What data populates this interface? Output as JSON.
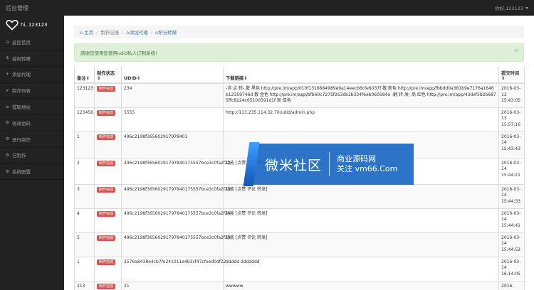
{
  "topbar": {
    "brand": "后台管理",
    "user": "你好,123123"
  },
  "sidebar": {
    "greeting": "hi, 123123",
    "items": [
      {
        "icon": "home-icon",
        "glyph": "⌂",
        "label": "返回首页"
      },
      {
        "icon": "money-icon",
        "glyph": "$",
        "label": "授权转赠"
      },
      {
        "icon": "plus-icon",
        "glyph": "+",
        "label": "添加代理"
      },
      {
        "icon": "check-icon",
        "glyph": "✔",
        "label": "制作列表"
      },
      {
        "icon": "list-icon",
        "glyph": "≡",
        "label": "提取地址"
      },
      {
        "icon": "gear-icon",
        "glyph": "⚙",
        "label": "修改密码"
      },
      {
        "icon": "gear-icon",
        "glyph": "⚙",
        "label": "进行制作"
      },
      {
        "icon": "gear-icon",
        "glyph": "⚙",
        "label": "已制作"
      },
      {
        "icon": "gear-icon",
        "glyph": "⚙",
        "label": "系统配置"
      }
    ]
  },
  "breadcrumb": [
    {
      "label": "⌂ 主页",
      "active": false
    },
    {
      "label": "制作记录",
      "active": true
    },
    {
      "label": "⌂添加代理",
      "active": false
    },
    {
      "label": "⌂积分转赠",
      "active": false
    }
  ],
  "alert": {
    "text": "感谢您使用您使用udid私人订制系统!",
    "close": "×"
  },
  "table": {
    "headers": [
      "备注⇕",
      "制作状态 ⇕",
      "UDID⇕",
      "下载链接⇕",
      "提交时间⇕"
    ],
    "rows": [
      {
        "note": "123123",
        "status": "制作完成",
        "udid": "234",
        "link": "-详 点 转- 散 黑色 http://pre.im/app/010f1316684989e9a14eecb6cfe6037f 散 粉色 http://pre.im/app/fbbdd0a381b9e7176a1646b12359746d 散 金色 http://pre.im/app/bfb60c7275f263db2b334f6eb060584a -翻 转 发- 商 红色 http://pre.im/app/43def5b2b6875ffc8224c65100591d1f 商 厚色",
        "time": "2016-03-13 15:43:05"
      },
      {
        "note": "123456",
        "status": "制作完成",
        "udid": "5555",
        "link": "http://113.235.114.32:70/udid/admin.php",
        "time": "2016-03-13 15:57:16"
      },
      {
        "note": "1",
        "status": "制作完成",
        "udid": "496c2198f365602917978401",
        "link": "",
        "time": "2016-03-14 15:43:43"
      },
      {
        "note": "2",
        "status": "制作完成",
        "udid": "496c2198f36560291797840175557bce3c0fa2f22",
        "link": "功能 [点赞 评论 转发]",
        "time": "2016-03-14 15:44:21"
      },
      {
        "note": "3",
        "status": "制作完成",
        "udid": "496c2198f36560291797840175557bce3c0fa2f23",
        "link": "功能 [点赞 评论 转发]",
        "time": "2016-03-14 15:44:33"
      },
      {
        "note": "4",
        "status": "制作完成",
        "udid": "496c2198f36560291797840175557bce3c0fa2f24",
        "link": "功能 [点赞 评论 转发]",
        "time": "2016-03-14 15:44:41"
      },
      {
        "note": "5",
        "status": "制作完成",
        "udid": "496c2198f36560291797840175557bce3c0fa2f25",
        "link": "功能 [点赞 评论 转发]",
        "time": "2016-03-14 15:44:52"
      },
      {
        "note": "1",
        "status": "制作完成",
        "udid": "2576a8438e4cb7fe241011e4b3cf47cfeed0df22",
        "link": "ddddd ddddddd",
        "time": "2016-03-14 16:14:05"
      },
      {
        "note": "213",
        "status": "制作完成",
        "udid": "21",
        "link": "wwwww",
        "time": "2016-"
      }
    ]
  },
  "watermark": {
    "main": "微米社区",
    "line1": "商业源码网",
    "line2": "关注 vm66.Com"
  }
}
